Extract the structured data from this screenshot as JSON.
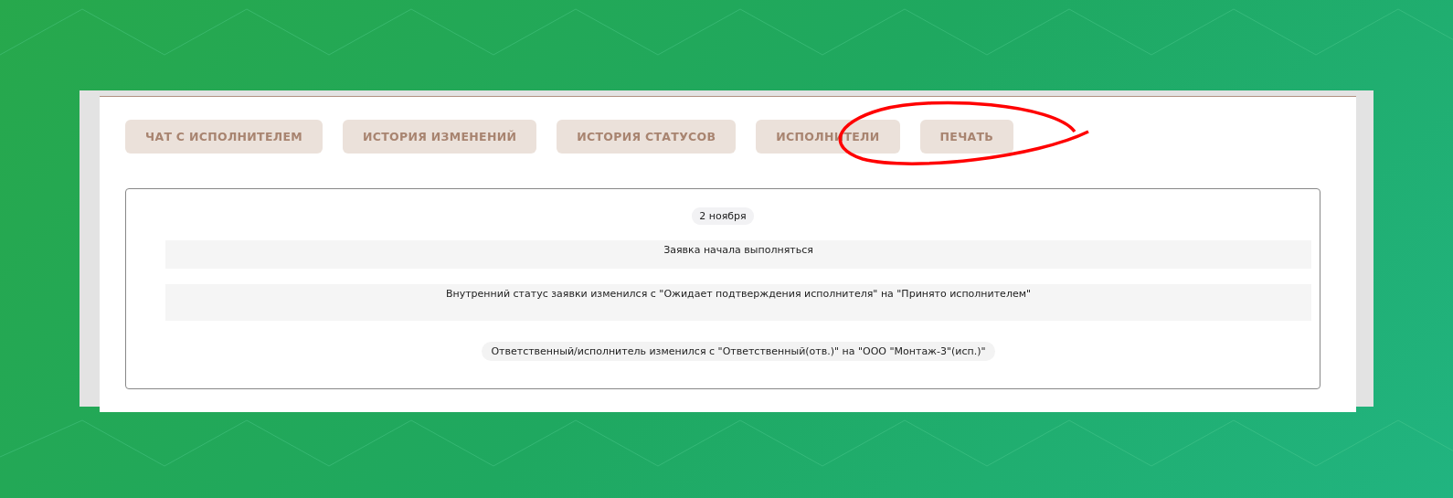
{
  "tabs": [
    {
      "label": "ЧАТ С ИСПОЛНИТЕЛЕМ",
      "selected": false
    },
    {
      "label": "ИСТОРИЯ ИЗМЕНЕНИЙ",
      "selected": false
    },
    {
      "label": "ИСТОРИЯ СТАТУСОВ",
      "selected": false
    },
    {
      "label": "ИСПОЛНИТЕЛИ",
      "selected": false
    },
    {
      "label": "ПЕЧАТЬ",
      "selected": false
    }
  ],
  "history": {
    "date": "2 ноября",
    "entries": [
      {
        "kind": "row",
        "text": "Заявка начала выполняться"
      },
      {
        "kind": "row",
        "text": "Внутренний статус заявки изменился с \"Ожидает подтверждения исполнителя\" на \"Принято исполнителем\""
      },
      {
        "kind": "pill",
        "text": "Ответственный/исполнитель изменился с \"Ответственный(отв.)\" на \"ООО \"Монтаж-3\"(исп.)\""
      }
    ]
  }
}
